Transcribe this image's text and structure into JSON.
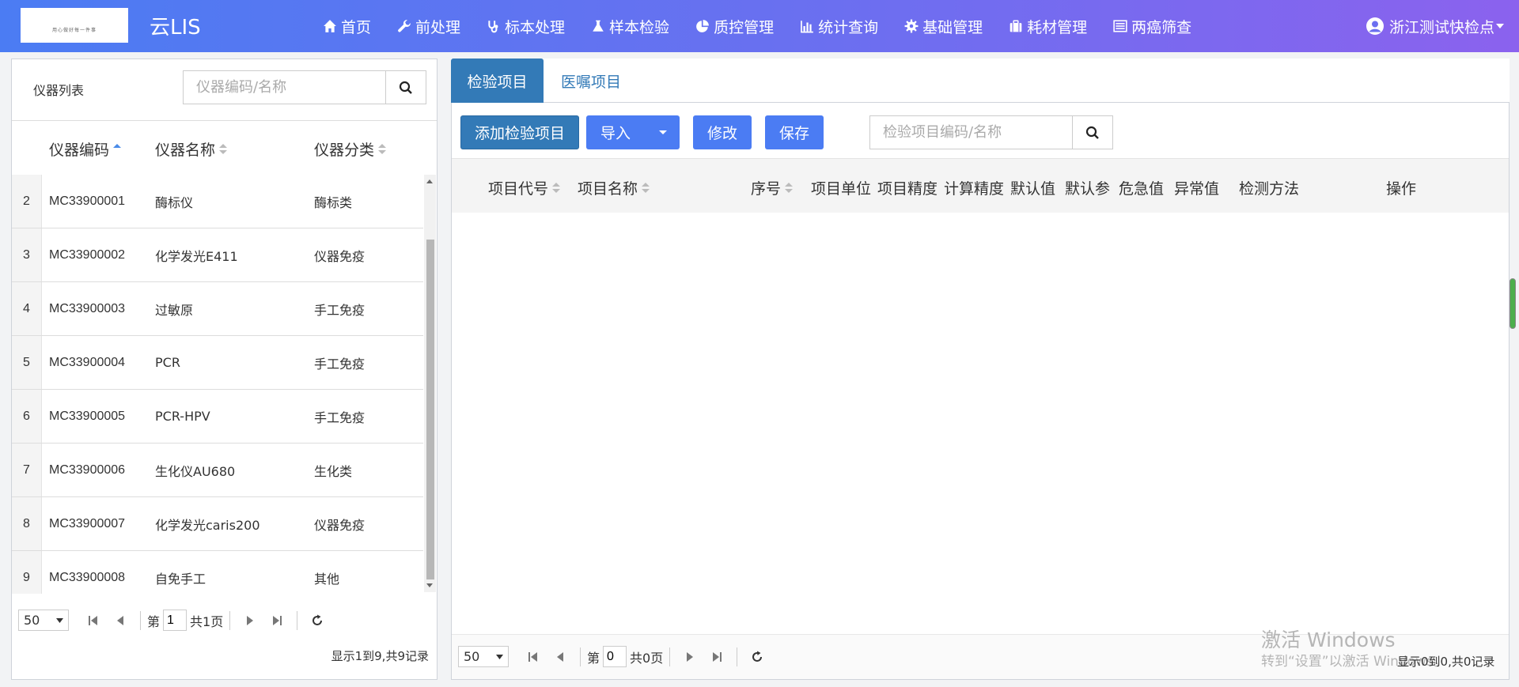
{
  "header": {
    "logo_text": "用心做好每一件事",
    "app_title": "云LIS",
    "nav": [
      {
        "label": "首页",
        "icon": "home-icon"
      },
      {
        "label": "前处理",
        "icon": "wrench-icon"
      },
      {
        "label": "标本处理",
        "icon": "stethoscope-icon"
      },
      {
        "label": "样本检验",
        "icon": "flask-icon"
      },
      {
        "label": "质控管理",
        "icon": "pie-chart-icon"
      },
      {
        "label": "统计查询",
        "icon": "bar-chart-icon"
      },
      {
        "label": "基础管理",
        "icon": "gear-icon"
      },
      {
        "label": "耗材管理",
        "icon": "briefcase-icon"
      },
      {
        "label": "两癌筛查",
        "icon": "list-icon"
      }
    ],
    "user": "浙江测试快检点"
  },
  "left": {
    "title": "仪器列表",
    "search_placeholder": "仪器编码/名称",
    "columns": [
      "仪器编码",
      "仪器名称",
      "仪器分类"
    ],
    "rows": [
      {
        "num": "2",
        "code": "MC33900001",
        "name": "酶标仪",
        "category": "酶标类"
      },
      {
        "num": "3",
        "code": "MC33900002",
        "name": "化学发光E411",
        "category": "仪器免疫"
      },
      {
        "num": "4",
        "code": "MC33900003",
        "name": "过敏原",
        "category": "手工免疫"
      },
      {
        "num": "5",
        "code": "MC33900004",
        "name": "PCR",
        "category": "手工免疫"
      },
      {
        "num": "6",
        "code": "MC33900005",
        "name": "PCR-HPV",
        "category": "手工免疫"
      },
      {
        "num": "7",
        "code": "MC33900006",
        "name": "生化仪AU680",
        "category": "生化类"
      },
      {
        "num": "8",
        "code": "MC33900007",
        "name": "化学发光caris200",
        "category": "仪器免疫"
      },
      {
        "num": "9",
        "code": "MC33900008",
        "name": "自免手工",
        "category": "其他"
      }
    ],
    "pager": {
      "page_size": "50",
      "page_prefix": "第",
      "page_value": "1",
      "total_pages": "共1页"
    },
    "info": "显示1到9,共9记录"
  },
  "right": {
    "tabs": [
      "检验项目",
      "医嘱项目"
    ],
    "buttons": {
      "add": "添加检验项目",
      "import": "导入",
      "edit": "修改",
      "save": "保存"
    },
    "search_placeholder": "检验项目编码/名称",
    "columns": [
      "项目代号",
      "项目名称",
      "序号",
      "项目单位",
      "项目精度",
      "计算精度",
      "默认值",
      "默认参",
      "危急值",
      "异常值",
      "检测方法",
      "操作"
    ],
    "pager": {
      "page_size": "50",
      "page_prefix": "第",
      "page_value": "0",
      "total_pages": "共0页"
    },
    "info": "显示0到0,共0记录"
  },
  "watermark": {
    "line1": "激活 Windows",
    "line2": "转到“设置”以激活 Windows。"
  }
}
